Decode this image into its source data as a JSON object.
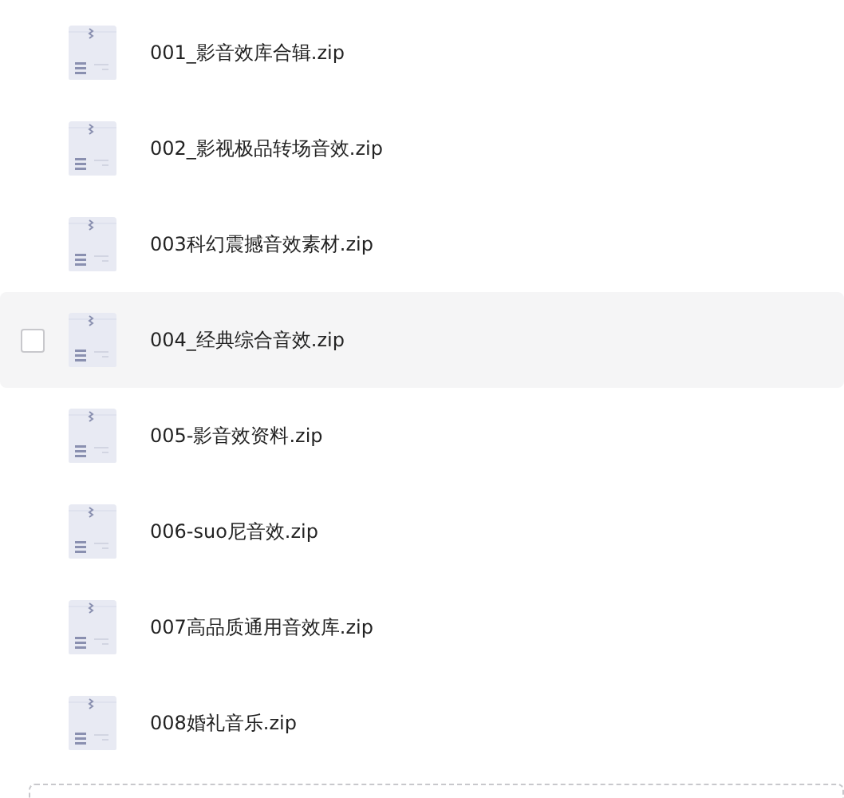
{
  "files": [
    {
      "name": "001_影音效库合辑.zip",
      "hovered": false
    },
    {
      "name": "002_影视极品转场音效.zip",
      "hovered": false
    },
    {
      "name": "003科幻震撼音效素材.zip",
      "hovered": false
    },
    {
      "name": "004_经典综合音效.zip",
      "hovered": true
    },
    {
      "name": "005-影音效资料.zip",
      "hovered": false
    },
    {
      "name": "006-suo尼音效.zip",
      "hovered": false
    },
    {
      "name": "007高品质通用音效库.zip",
      "hovered": false
    },
    {
      "name": "008婚礼音乐.zip",
      "hovered": false
    }
  ]
}
